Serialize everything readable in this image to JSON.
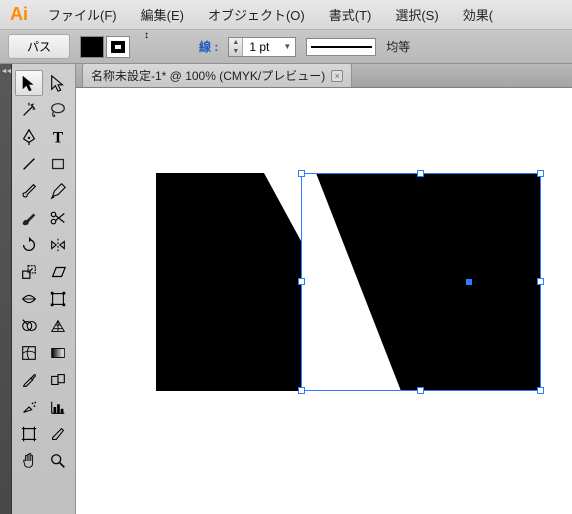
{
  "app": {
    "icon_label": "Ai"
  },
  "menu": {
    "file": "ファイル(F)",
    "edit": "編集(E)",
    "object": "オブジェクト(O)",
    "type": "書式(T)",
    "select": "選択(S)",
    "effect": "効果("
  },
  "control": {
    "selected_object": "パス",
    "stroke_label": "線 :",
    "stroke_weight": "1 pt",
    "profile": "均等"
  },
  "document": {
    "tab_title": "名称未設定-1* @ 100% (CMYK/プレビュー)",
    "close_glyph": "×"
  },
  "colors": {
    "accent": "#ff8a00",
    "black": "#000000",
    "selection": "#2e7cff"
  }
}
